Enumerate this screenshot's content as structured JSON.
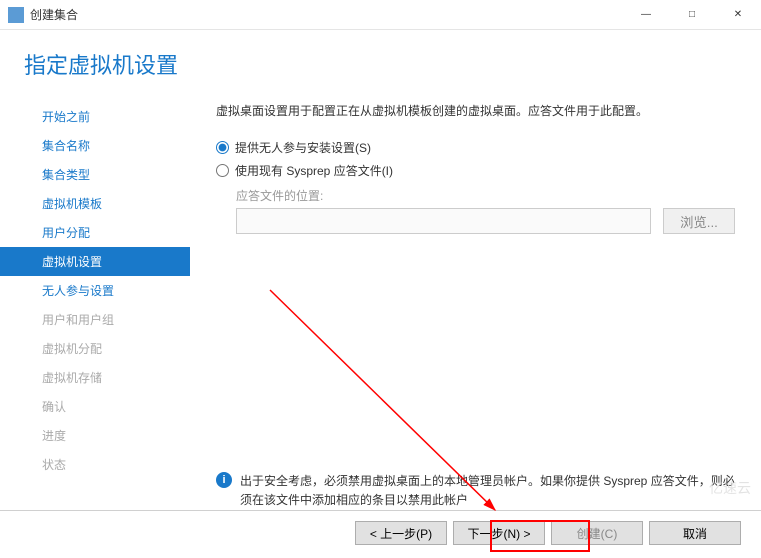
{
  "titlebar": {
    "title": "创建集合",
    "minimize": "—",
    "maximize": "□",
    "close": "✕"
  },
  "header": {
    "title": "指定虚拟机设置"
  },
  "sidebar": {
    "items": [
      {
        "label": "开始之前",
        "state": "normal"
      },
      {
        "label": "集合名称",
        "state": "normal"
      },
      {
        "label": "集合类型",
        "state": "normal"
      },
      {
        "label": "虚拟机模板",
        "state": "normal"
      },
      {
        "label": "用户分配",
        "state": "normal"
      },
      {
        "label": "虚拟机设置",
        "state": "active"
      },
      {
        "label": "无人参与设置",
        "state": "normal"
      },
      {
        "label": "用户和用户组",
        "state": "disabled"
      },
      {
        "label": "虚拟机分配",
        "state": "disabled"
      },
      {
        "label": "虚拟机存储",
        "state": "disabled"
      },
      {
        "label": "确认",
        "state": "disabled"
      },
      {
        "label": "进度",
        "state": "disabled"
      },
      {
        "label": "状态",
        "state": "disabled"
      }
    ]
  },
  "content": {
    "description": "虚拟桌面设置用于配置正在从虚拟机模板创建的虚拟桌面。应答文件用于此配置。",
    "radio1": "提供无人参与安装设置(S)",
    "radio2": "使用现有 Sysprep 应答文件(I)",
    "path_label": "应答文件的位置:",
    "path_value": "",
    "browse_label": "浏览...",
    "info_text": "出于安全考虑，必须禁用虚拟桌面上的本地管理员帐户。如果你提供 Sysprep 应答文件，则必须在该文件中添加相应的条目以禁用此帐户"
  },
  "footer": {
    "prev": "< 上一步(P)",
    "next": "下一步(N) >",
    "create": "创建(C)",
    "cancel": "取消"
  },
  "watermark": "亿速云"
}
